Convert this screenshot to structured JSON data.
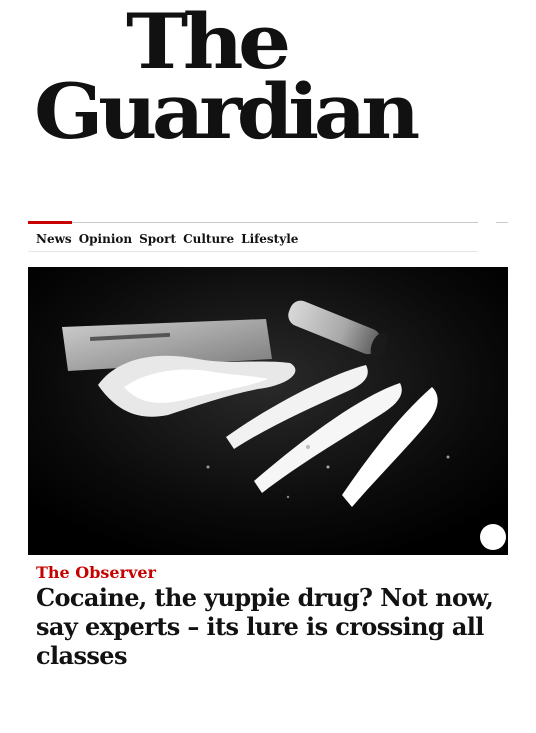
{
  "masthead": {
    "line1": "The",
    "line2": "Guardian"
  },
  "nav": {
    "items": [
      "News",
      "Opinion",
      "Sport",
      "Culture",
      "Lifestyle"
    ]
  },
  "article": {
    "kicker": "The Observer",
    "headline": "Cocaine, the yuppie drug? Not now, say experts – its lure is crossing all classes"
  },
  "colors": {
    "kicker": "#c70000",
    "nav_accent": "#c70000",
    "text": "#121212"
  }
}
